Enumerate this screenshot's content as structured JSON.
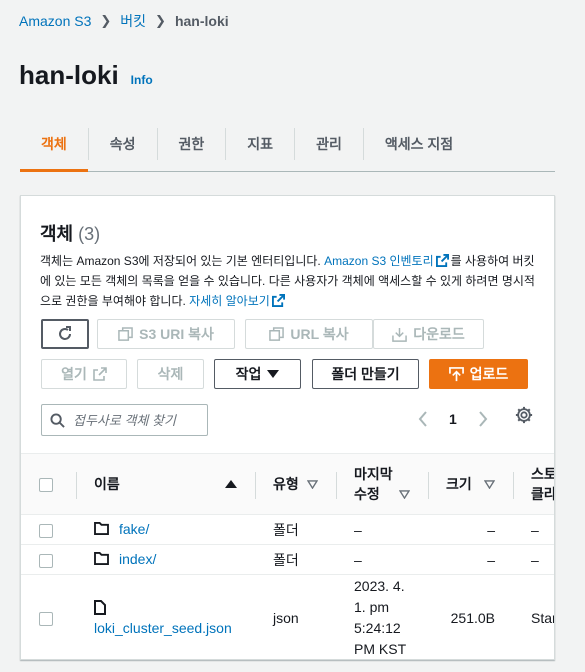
{
  "breadcrumb": {
    "items": [
      "Amazon S3",
      "버킷"
    ],
    "current": "han-loki",
    "separator": "❯"
  },
  "header": {
    "title": "han-loki",
    "info": "Info"
  },
  "tabs": [
    "객체",
    "속성",
    "권한",
    "지표",
    "관리",
    "액세스 지점"
  ],
  "panel": {
    "title": "객체",
    "count": "(3)",
    "desc_1": "객체는 Amazon S3에 저장되어 있는 기본 엔터티입니다. ",
    "desc_link_1": "Amazon S3 인벤토리",
    "desc_2": "를 사용하여 버킷에 있는 모든 객체의 목록을 얻을 수 있습니다. 다른 사용자가 객체에 액세스할 수 있게 하려면 명시적으로 권한을 부여해야 합니다. ",
    "desc_link_2": "자세히 알아보기"
  },
  "toolbar": {
    "copy_s3_uri": "S3 URI 복사",
    "copy_url": "URL 복사",
    "download": "다운로드",
    "open": "열기",
    "delete": "삭제",
    "actions": "작업",
    "create_folder": "폴더 만들기",
    "upload": "업로드"
  },
  "search": {
    "placeholder": "접두사로 객체 찾기"
  },
  "pagination": {
    "page": "1"
  },
  "table": {
    "headers": {
      "name": "이름",
      "type": "유형",
      "modified_1": "마지막",
      "modified_2": "수정",
      "size": "크기",
      "storage_1": "스토",
      "storage_2": "클라"
    },
    "rows": [
      {
        "name": "fake/",
        "type": "폴더",
        "modified": "–",
        "size": "–",
        "storage": "–",
        "kind": "folder"
      },
      {
        "name": "index/",
        "type": "폴더",
        "modified": "–",
        "size": "–",
        "storage": "–",
        "kind": "folder"
      },
      {
        "name": "loki_cluster_seed.json",
        "type": "json",
        "modified_lines": [
          "2023. 4.",
          "1. pm",
          "5:24:12",
          "PM KST"
        ],
        "size": "251.0B",
        "storage": "Stan",
        "kind": "file"
      }
    ]
  },
  "colors": {
    "accent": "#ec7211",
    "link": "#0073bb",
    "text": "#16191f",
    "muted": "#545b64"
  },
  "icons": [
    "refresh-icon",
    "copy-icon",
    "download-icon",
    "external-link-icon",
    "caret-down-icon",
    "upload-icon",
    "search-icon",
    "chevron-left-icon",
    "chevron-right-icon",
    "gear-icon",
    "sort-up-icon",
    "sort-down-icon",
    "folder-icon",
    "file-icon"
  ]
}
